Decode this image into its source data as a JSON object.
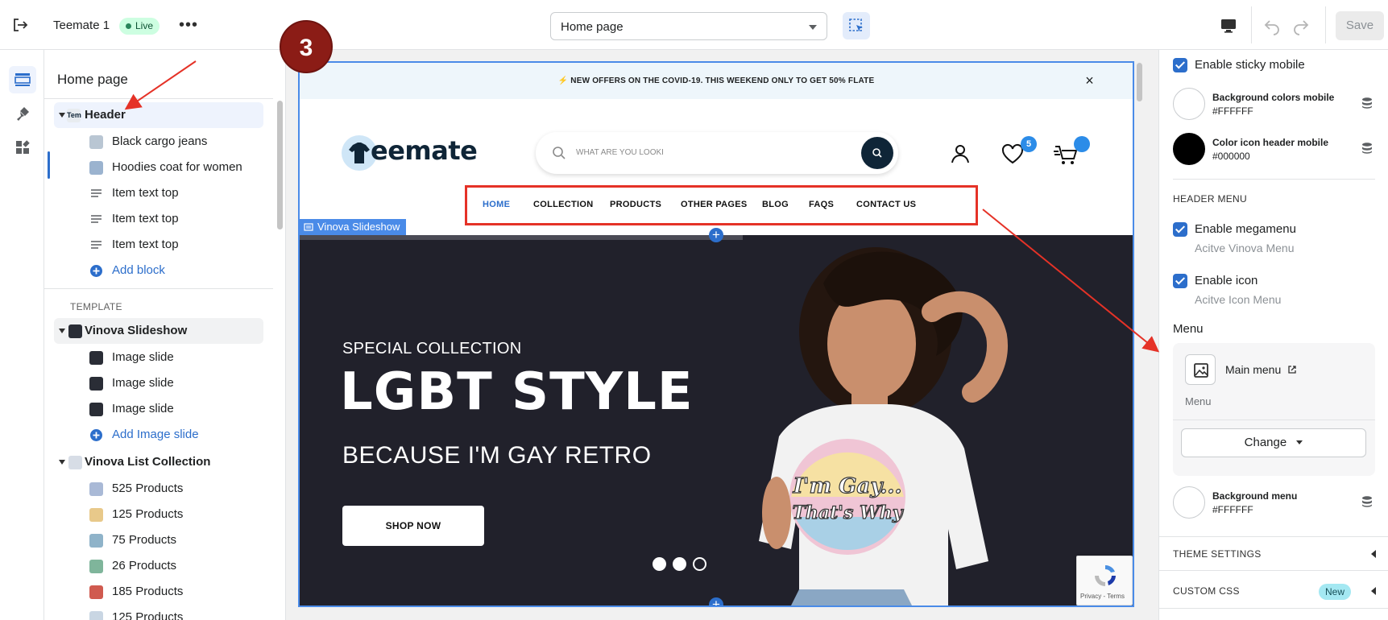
{
  "topbar": {
    "theme_name": "Teemate 1",
    "status": "Live",
    "page_selected": "Home page",
    "save_label": "Save"
  },
  "sidebar": {
    "title": "Home page",
    "header_group": {
      "label": "Header",
      "items": [
        "Black cargo jeans",
        "Hoodies coat for women",
        "Item text top",
        "Item text top",
        "Item text top"
      ],
      "add_label": "Add block"
    },
    "template_label": "TEMPLATE",
    "slideshow_group": {
      "label": "Vinova Slideshow",
      "items": [
        "Image slide",
        "Image slide",
        "Image slide"
      ],
      "add_label": "Add Image slide"
    },
    "list_collection_group": {
      "label": "Vinova List Collection",
      "items": [
        "525 Products",
        "125 Products",
        "75 Products",
        "26 Products",
        "185 Products",
        "125 Products"
      ]
    }
  },
  "preview": {
    "announcement": "NEW OFFERS ON THE COVID-19. THIS WEEKEND ONLY TO GET 50% FLATE",
    "logo_text": "eemate",
    "search_placeholder": "WHAT ARE YOU LOOKI",
    "wishlist_count": "5",
    "nav": [
      "HOME",
      "COLLECTION",
      "PRODUCTS",
      "OTHER PAGES",
      "BLOG",
      "FAQS",
      "CONTACT US"
    ],
    "section_badge": "Vinova Slideshow",
    "hero": {
      "kicker": "SPECIAL COLLECTION",
      "title": "LGBT STYLE",
      "subtitle": "BECAUSE I'M GAY RETRO",
      "button": "SHOP NOW",
      "shirt_print": "I'm Gay... That's Why",
      "slide_dots_active": 3
    },
    "recaptcha_text": "Privacy - Terms"
  },
  "settings": {
    "enable_sticky_mobile": "Enable sticky mobile",
    "bg_colors_mobile": {
      "label": "Background colors mobile",
      "hex": "#FFFFFF"
    },
    "color_icon_header_mobile": {
      "label": "Color icon header mobile",
      "hex": "#000000"
    },
    "header_menu_caption": "HEADER MENU",
    "enable_megamenu": "Enable megamenu",
    "megamenu_hint": "Acitve Vinova Menu",
    "enable_icon": "Enable icon",
    "icon_hint": "Acitve Icon Menu",
    "menu_label": "Menu",
    "menu_name": "Main menu",
    "menu_caption": "Menu",
    "change_label": "Change",
    "background_menu": {
      "label": "Background menu",
      "hex": "#FFFFFF"
    },
    "theme_settings": "THEME SETTINGS",
    "custom_css": "CUSTOM CSS",
    "new_badge": "New"
  },
  "annotation": {
    "step_number": "3"
  },
  "colors": {
    "accent": "#2c6ecb",
    "annotation_red": "#e53227",
    "step_bg": "#8b1c16"
  }
}
